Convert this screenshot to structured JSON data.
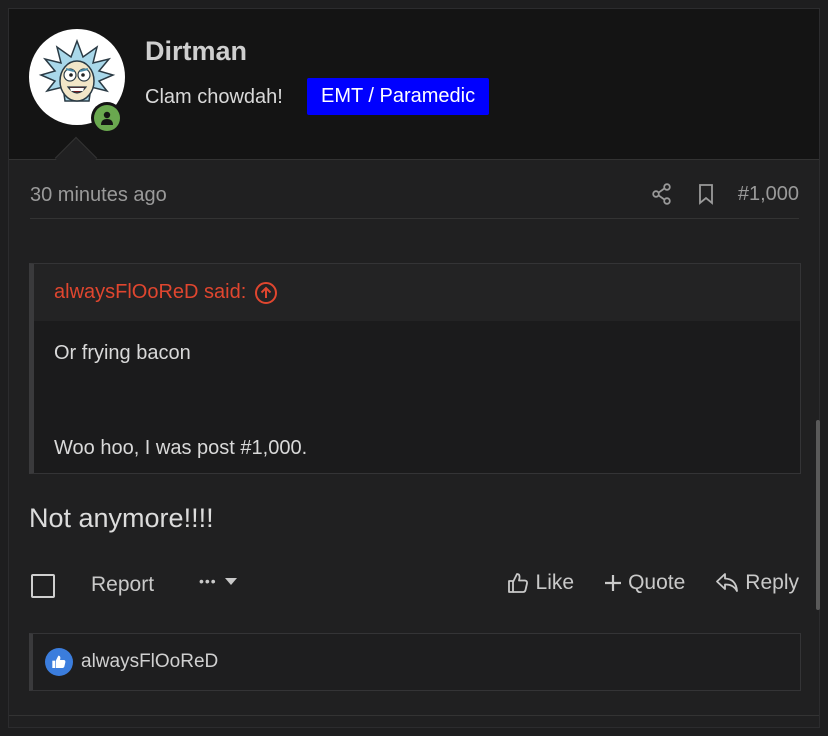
{
  "post": {
    "username": "Dirtman",
    "user_title": "Clam chowdah!",
    "user_badge": "EMT / Paramedic",
    "time": "30 minutes ago",
    "post_number": "#1,000",
    "text": "Not anymore!!!!"
  },
  "quote": {
    "author": "alwaysFlOoReD said:",
    "lines": [
      "Or frying bacon",
      "Woo hoo, I was post #1,000."
    ]
  },
  "actions": {
    "report": "Report",
    "more": "•••",
    "like": "Like",
    "quote": "Quote",
    "reply": "Reply"
  },
  "reactions": {
    "user": "alwaysFlOoReD"
  },
  "colors": {
    "badge_bg": "#0000ff",
    "quote_author": "#e0462f",
    "online": "#6aa84f",
    "like_badge": "#3b7ddd"
  },
  "icons": {
    "avatar": "rick-avatar-icon",
    "online": "user-online-icon",
    "share": "share-icon",
    "bookmark": "bookmark-icon",
    "quote_jump": "arrow-up-circle-icon",
    "like": "thumbs-up-icon",
    "reply": "reply-arrow-icon"
  }
}
